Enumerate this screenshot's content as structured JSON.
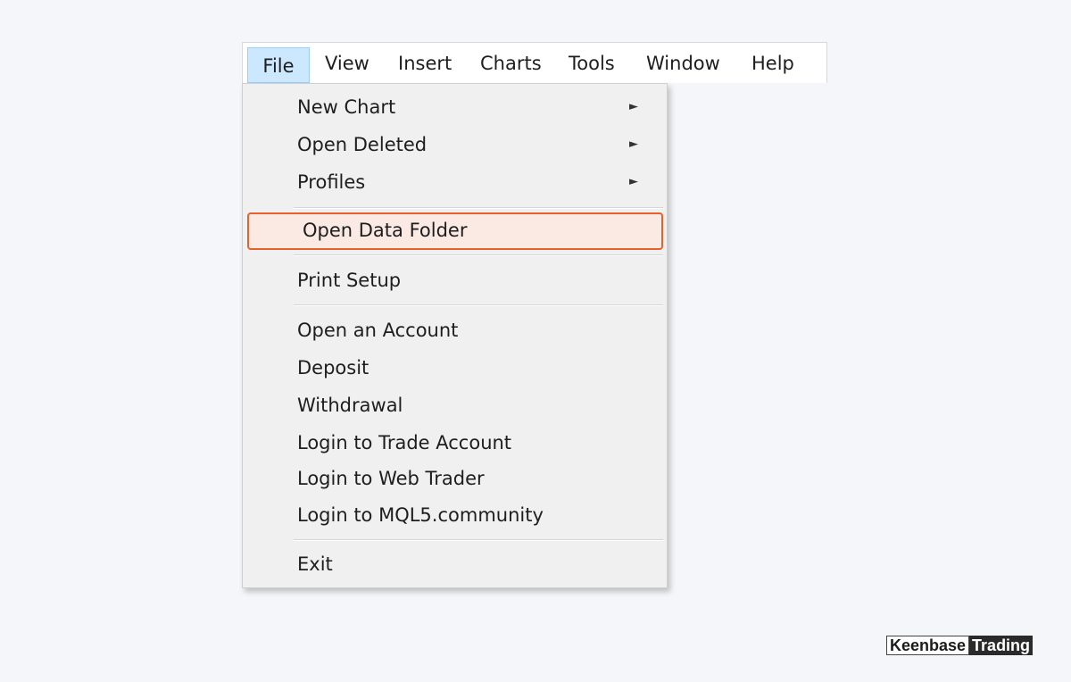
{
  "menubar": {
    "items": [
      {
        "label": "File",
        "active": true
      },
      {
        "label": "View"
      },
      {
        "label": "Insert"
      },
      {
        "label": "Charts"
      },
      {
        "label": "Tools"
      },
      {
        "label": "Window"
      },
      {
        "label": "Help"
      }
    ]
  },
  "file_menu": {
    "submenu_arrow": "►",
    "items": [
      {
        "label": "New Chart",
        "has_submenu": true
      },
      {
        "label": "Open Deleted",
        "has_submenu": true
      },
      {
        "label": "Profiles",
        "has_submenu": true
      },
      {
        "label": "Open Data Folder",
        "highlighted": true
      },
      {
        "label": "Print Setup"
      },
      {
        "label": "Open an Account"
      },
      {
        "label": "Deposit"
      },
      {
        "label": "Withdrawal"
      },
      {
        "label": "Login to Trade Account"
      },
      {
        "label": "Login to Web Trader"
      },
      {
        "label": "Login to MQL5.community"
      },
      {
        "label": "Exit"
      }
    ]
  },
  "highlight_color": "#e8612c",
  "watermark": {
    "part1": "Keenbase",
    "part2": "Trading"
  }
}
